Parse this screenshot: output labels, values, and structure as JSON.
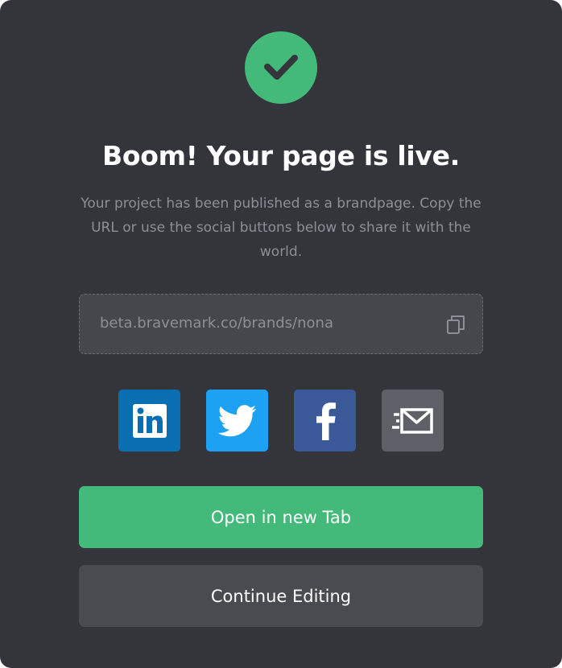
{
  "dialog": {
    "title": "Boom! Your page is live.",
    "subtitle": "Your project has been published as a brandpage. Copy the URL or use the social buttons below to share it with the world.",
    "url": "beta.bravemark.co/brands/nona",
    "icons": {
      "status": "check-icon",
      "copy": "copy-icon"
    }
  },
  "share": [
    {
      "name": "linkedin",
      "icon": "linkedin-icon",
      "color": "#0a6fb2"
    },
    {
      "name": "twitter",
      "icon": "twitter-icon",
      "color": "#1da1f2"
    },
    {
      "name": "facebook",
      "icon": "facebook-icon",
      "color": "#3b5998"
    },
    {
      "name": "email",
      "icon": "email-icon",
      "color": "#5f5f67"
    }
  ],
  "buttons": {
    "primary_label": "Open in new Tab",
    "secondary_label": "Continue Editing"
  },
  "colors": {
    "background": "#34343b",
    "accent": "#43b97a",
    "secondary_button": "#4a4a51",
    "muted_text": "#8e8e96"
  }
}
